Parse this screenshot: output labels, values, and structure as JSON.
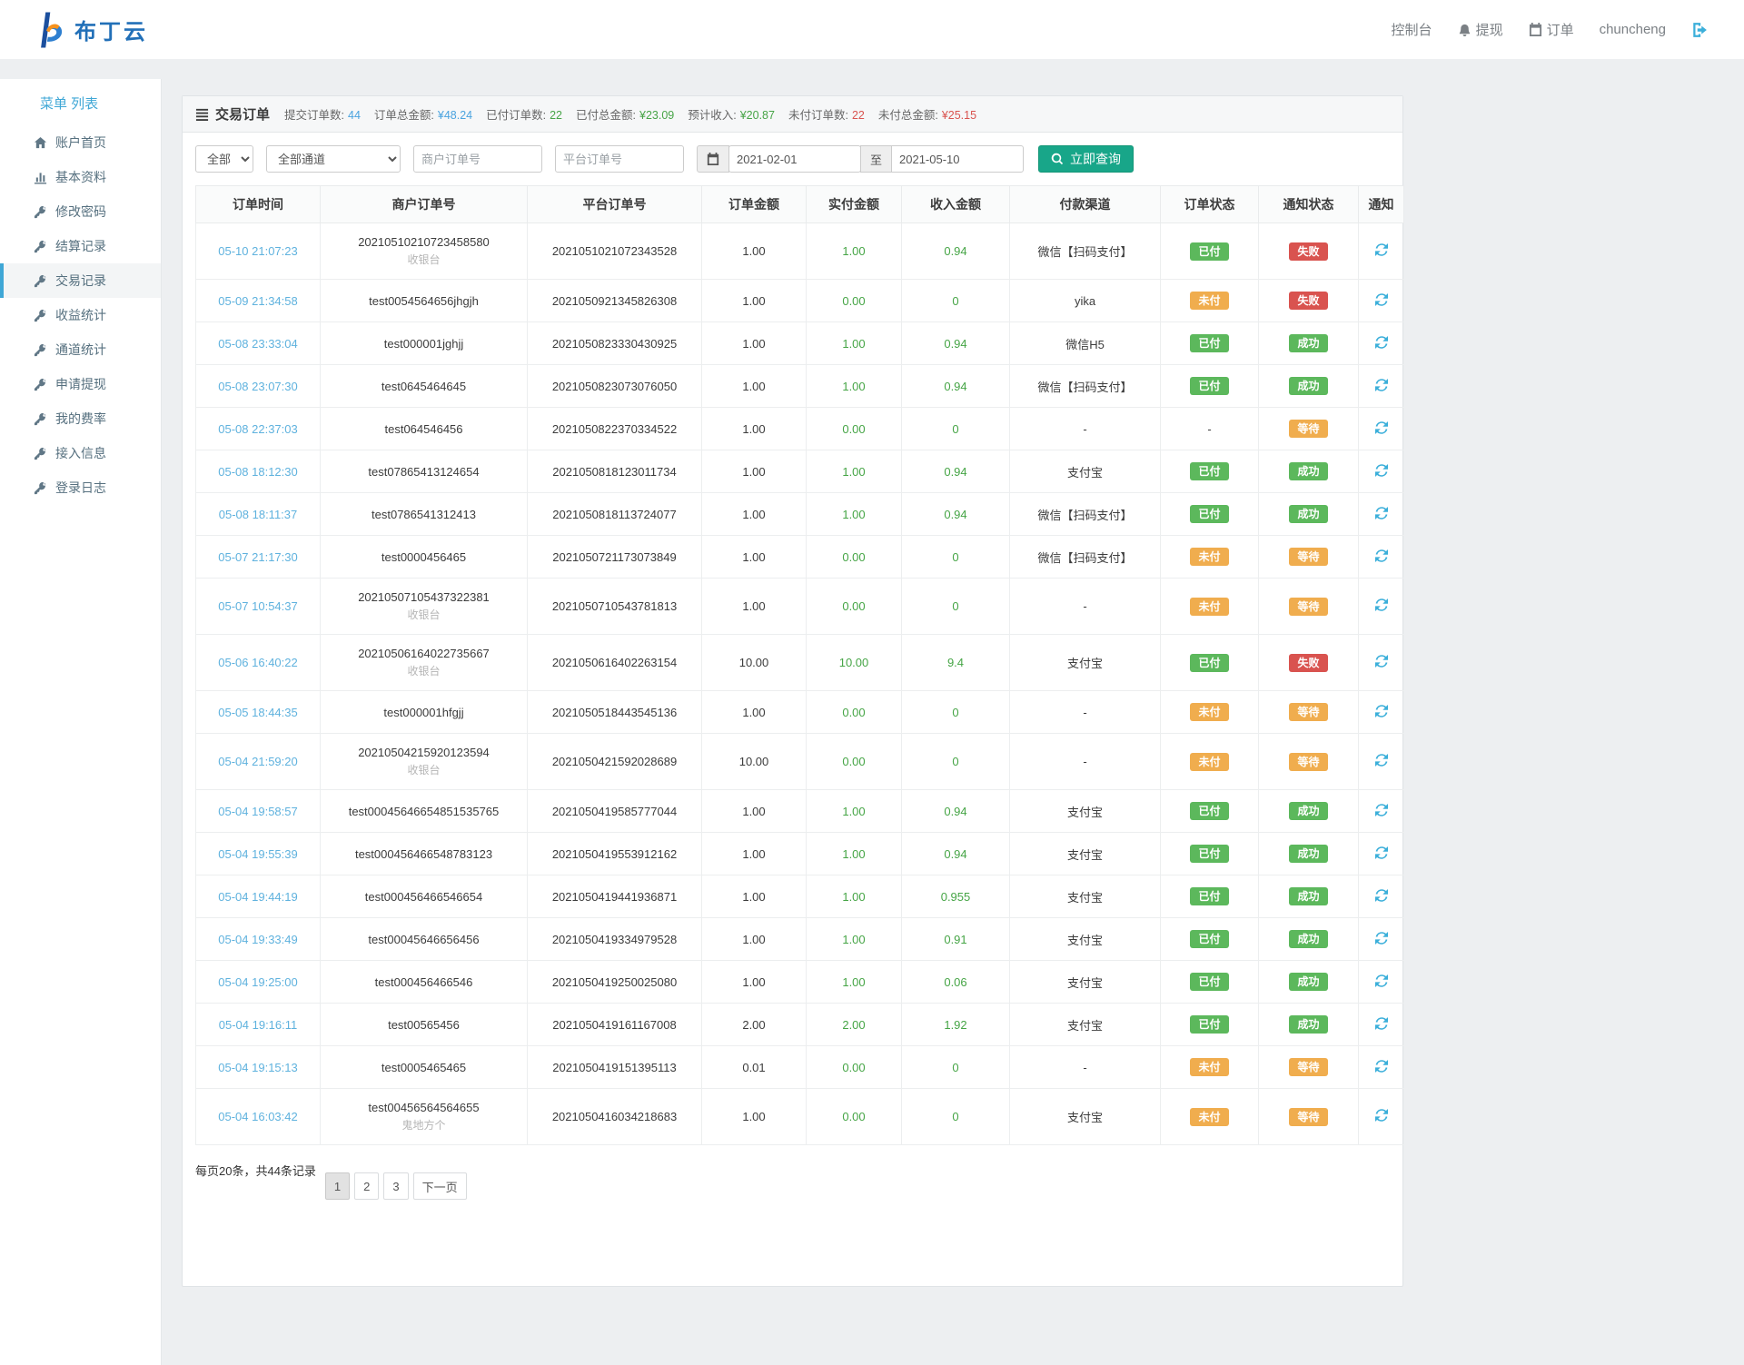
{
  "brand": {
    "name": "布丁云"
  },
  "topnav": {
    "console": "控制台",
    "withdraw": "提现",
    "orders": "订单",
    "username": "chuncheng"
  },
  "sidebar": {
    "title": "菜单 列表",
    "items": [
      {
        "label": "账户首页",
        "icon": "home",
        "active": false
      },
      {
        "label": "基本资料",
        "icon": "chart",
        "active": false
      },
      {
        "label": "修改密码",
        "icon": "key",
        "active": false
      },
      {
        "label": "结算记录",
        "icon": "key",
        "active": false
      },
      {
        "label": "交易记录",
        "icon": "key",
        "active": true
      },
      {
        "label": "收益统计",
        "icon": "key",
        "active": false
      },
      {
        "label": "通道统计",
        "icon": "key",
        "active": false
      },
      {
        "label": "申请提现",
        "icon": "key",
        "active": false
      },
      {
        "label": "我的费率",
        "icon": "key",
        "active": false
      },
      {
        "label": "接入信息",
        "icon": "key",
        "active": false
      },
      {
        "label": "登录日志",
        "icon": "key",
        "active": false
      }
    ]
  },
  "panel": {
    "title": "交易订单",
    "stats": [
      {
        "label": "提交订单数:",
        "value": "44",
        "color": "#4aa3df"
      },
      {
        "label": "订单总金额:",
        "value": "¥48.24",
        "color": "#4aa3df"
      },
      {
        "label": "已付订单数:",
        "value": "22",
        "color": "#47a447"
      },
      {
        "label": "已付总金额:",
        "value": "¥23.09",
        "color": "#47a447"
      },
      {
        "label": "预计收入:",
        "value": "¥20.87",
        "color": "#47a447"
      },
      {
        "label": "未付订单数:",
        "value": "22",
        "color": "#d9534f"
      },
      {
        "label": "未付总金额:",
        "value": "¥25.15",
        "color": "#d9534f"
      }
    ]
  },
  "filters": {
    "status_select": "全部",
    "channel_select": "全部通道",
    "merchant_placeholder": "商户订单号",
    "platform_placeholder": "平台订单号",
    "date_from": "2021-02-01",
    "date_separator": "至",
    "date_to": "2021-05-10",
    "search_label": "立即查询"
  },
  "table": {
    "headers": [
      "订单时间",
      "商户订单号",
      "平台订单号",
      "订单金额",
      "实付金额",
      "收入金额",
      "付款渠道",
      "订单状态",
      "通知状态",
      "通知"
    ],
    "badges": {
      "paid": "已付",
      "unpaid": "未付",
      "none": "-",
      "success": "成功",
      "fail": "失败",
      "wait": "等待"
    },
    "rows": [
      {
        "time": "05-10 21:07:23",
        "merchant": "20210510210723458580",
        "sub": "收银台",
        "platform": "2021051021072343528",
        "amount": "1.00",
        "paid": "1.00",
        "income": "0.94",
        "channel": "微信【扫码支付】",
        "status": "paid",
        "notify": "fail"
      },
      {
        "time": "05-09 21:34:58",
        "merchant": "test0054564656jhgjh",
        "sub": "",
        "platform": "2021050921345826308",
        "amount": "1.00",
        "paid": "0.00",
        "income": "0",
        "channel": "yika",
        "status": "unpaid",
        "notify": "fail"
      },
      {
        "time": "05-08 23:33:04",
        "merchant": "test000001jghjj",
        "sub": "",
        "platform": "2021050823330430925",
        "amount": "1.00",
        "paid": "1.00",
        "income": "0.94",
        "channel": "微信H5",
        "status": "paid",
        "notify": "success"
      },
      {
        "time": "05-08 23:07:30",
        "merchant": "test0645464645",
        "sub": "",
        "platform": "2021050823073076050",
        "amount": "1.00",
        "paid": "1.00",
        "income": "0.94",
        "channel": "微信【扫码支付】",
        "status": "paid",
        "notify": "success"
      },
      {
        "time": "05-08 22:37:03",
        "merchant": "test064546456",
        "sub": "",
        "platform": "2021050822370334522",
        "amount": "1.00",
        "paid": "0.00",
        "income": "0",
        "channel": "-",
        "status": "none",
        "notify": "wait"
      },
      {
        "time": "05-08 18:12:30",
        "merchant": "test07865413124654",
        "sub": "",
        "platform": "2021050818123011734",
        "amount": "1.00",
        "paid": "1.00",
        "income": "0.94",
        "channel": "支付宝",
        "status": "paid",
        "notify": "success"
      },
      {
        "time": "05-08 18:11:37",
        "merchant": "test0786541312413",
        "sub": "",
        "platform": "2021050818113724077",
        "amount": "1.00",
        "paid": "1.00",
        "income": "0.94",
        "channel": "微信【扫码支付】",
        "status": "paid",
        "notify": "success"
      },
      {
        "time": "05-07 21:17:30",
        "merchant": "test0000456465",
        "sub": "",
        "platform": "2021050721173073849",
        "amount": "1.00",
        "paid": "0.00",
        "income": "0",
        "channel": "微信【扫码支付】",
        "status": "unpaid",
        "notify": "wait"
      },
      {
        "time": "05-07 10:54:37",
        "merchant": "20210507105437322381",
        "sub": "收银台",
        "platform": "2021050710543781813",
        "amount": "1.00",
        "paid": "0.00",
        "income": "0",
        "channel": "-",
        "status": "unpaid",
        "notify": "wait"
      },
      {
        "time": "05-06 16:40:22",
        "merchant": "20210506164022735667",
        "sub": "收银台",
        "platform": "2021050616402263154",
        "amount": "10.00",
        "paid": "10.00",
        "income": "9.4",
        "channel": "支付宝",
        "status": "paid",
        "notify": "fail"
      },
      {
        "time": "05-05 18:44:35",
        "merchant": "test000001hfgjj",
        "sub": "",
        "platform": "2021050518443545136",
        "amount": "1.00",
        "paid": "0.00",
        "income": "0",
        "channel": "-",
        "status": "unpaid",
        "notify": "wait"
      },
      {
        "time": "05-04 21:59:20",
        "merchant": "20210504215920123594",
        "sub": "收银台",
        "platform": "2021050421592028689",
        "amount": "10.00",
        "paid": "0.00",
        "income": "0",
        "channel": "-",
        "status": "unpaid",
        "notify": "wait"
      },
      {
        "time": "05-04 19:58:57",
        "merchant": "test00045646654851535765",
        "sub": "",
        "platform": "2021050419585777044",
        "amount": "1.00",
        "paid": "1.00",
        "income": "0.94",
        "channel": "支付宝",
        "status": "paid",
        "notify": "success"
      },
      {
        "time": "05-04 19:55:39",
        "merchant": "test000456466548783123",
        "sub": "",
        "platform": "2021050419553912162",
        "amount": "1.00",
        "paid": "1.00",
        "income": "0.94",
        "channel": "支付宝",
        "status": "paid",
        "notify": "success"
      },
      {
        "time": "05-04 19:44:19",
        "merchant": "test000456466546654",
        "sub": "",
        "platform": "2021050419441936871",
        "amount": "1.00",
        "paid": "1.00",
        "income": "0.955",
        "channel": "支付宝",
        "status": "paid",
        "notify": "success"
      },
      {
        "time": "05-04 19:33:49",
        "merchant": "test00045646656456",
        "sub": "",
        "platform": "2021050419334979528",
        "amount": "1.00",
        "paid": "1.00",
        "income": "0.91",
        "channel": "支付宝",
        "status": "paid",
        "notify": "success"
      },
      {
        "time": "05-04 19:25:00",
        "merchant": "test000456466546",
        "sub": "",
        "platform": "2021050419250025080",
        "amount": "1.00",
        "paid": "1.00",
        "income": "0.06",
        "channel": "支付宝",
        "status": "paid",
        "notify": "success"
      },
      {
        "time": "05-04 19:16:11",
        "merchant": "test00565456",
        "sub": "",
        "platform": "2021050419161167008",
        "amount": "2.00",
        "paid": "2.00",
        "income": "1.92",
        "channel": "支付宝",
        "status": "paid",
        "notify": "success"
      },
      {
        "time": "05-04 19:15:13",
        "merchant": "test0005465465",
        "sub": "",
        "platform": "2021050419151395113",
        "amount": "0.01",
        "paid": "0.00",
        "income": "0",
        "channel": "-",
        "status": "unpaid",
        "notify": "wait"
      },
      {
        "time": "05-04 16:03:42",
        "merchant": "test00456564564655",
        "sub": "鬼地方个",
        "platform": "2021050416034218683",
        "amount": "1.00",
        "paid": "0.00",
        "income": "0",
        "channel": "支付宝",
        "status": "unpaid",
        "notify": "wait"
      }
    ]
  },
  "pagination": {
    "summary": "每页20条，共44条记录",
    "pages": [
      "1",
      "2",
      "3"
    ],
    "active": "1",
    "next": "下一页"
  }
}
